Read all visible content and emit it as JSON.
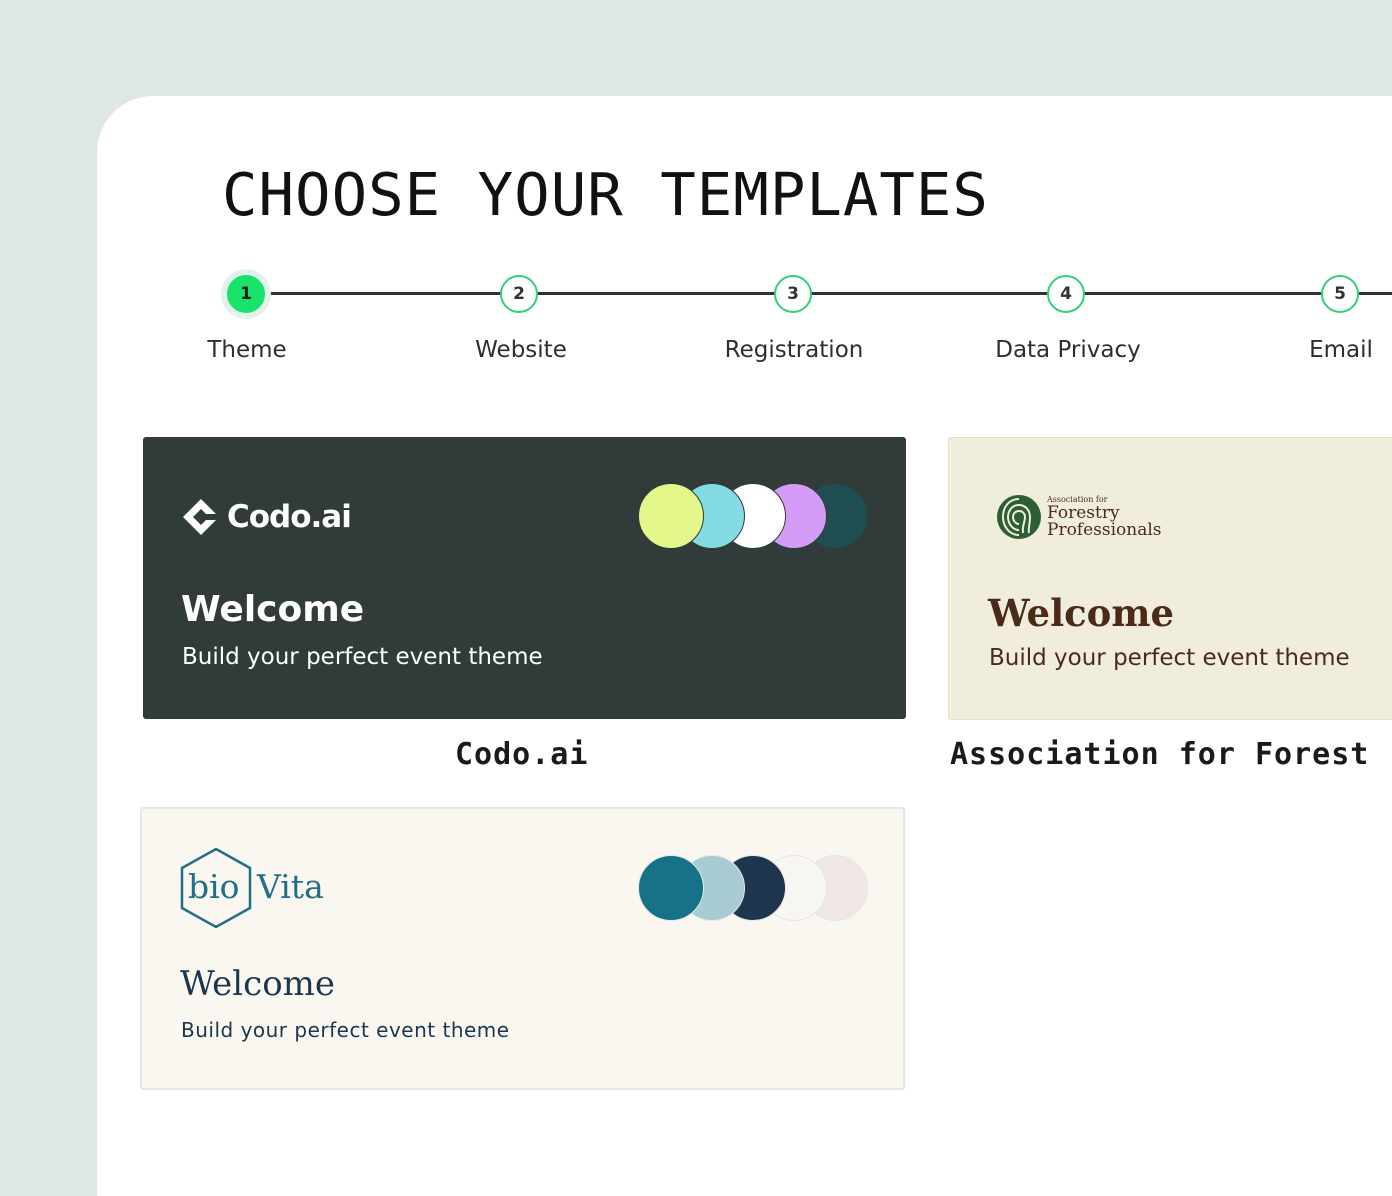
{
  "page": {
    "title": "CHOOSE YOUR TEMPLATES"
  },
  "stepper": {
    "steps": [
      {
        "number": "1",
        "label": "Theme",
        "active": true
      },
      {
        "number": "2",
        "label": "Website",
        "active": false
      },
      {
        "number": "3",
        "label": "Registration",
        "active": false
      },
      {
        "number": "4",
        "label": "Data Privacy",
        "active": false
      },
      {
        "number": "5",
        "label": "Email",
        "active": false
      }
    ]
  },
  "templates": [
    {
      "name": "Codo.ai",
      "logo_text": "Codo.ai",
      "welcome": "Welcome",
      "subtitle": "Build your perfect event theme",
      "palette": [
        "#e3f78a",
        "#84dbe3",
        "#ffffff",
        "#d59cf7",
        "#1f4f52"
      ]
    },
    {
      "name": "Association for Forest",
      "logo_small": "Association for",
      "logo_line1": "Forestry",
      "logo_line2": "Professionals",
      "welcome": "Welcome",
      "subtitle": "Build your perfect event theme"
    },
    {
      "name": "",
      "logo_left": "bio",
      "logo_right": "Vita",
      "welcome": "Welcome",
      "subtitle": "Build your perfect event theme",
      "palette": [
        "#167288",
        "#a9cbd4",
        "#1e3550",
        "#f8f6f3",
        "#efe6e5"
      ]
    }
  ],
  "colors": {
    "accent": "#19e26a",
    "dark_card": "#313c3a",
    "forest_brown": "#4a2b1a",
    "forest_green": "#2e5e34",
    "biovita_teal": "#1f6f86",
    "biovita_navy": "#1e3550"
  }
}
